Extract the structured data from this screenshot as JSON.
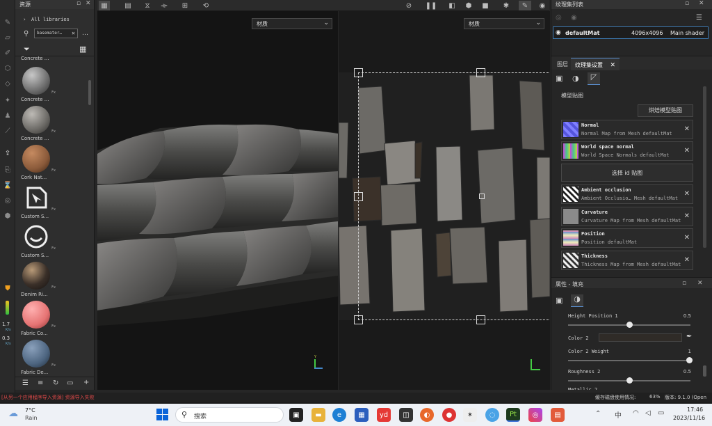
{
  "assets": {
    "title": "资源",
    "library_label": "All libraries",
    "search_value": "basemater…",
    "items": [
      {
        "label": "Concrete ...",
        "color": "#8a8a8a"
      },
      {
        "label": "Concrete ...",
        "color": "#7a7874"
      },
      {
        "label": "Cork Nat...",
        "color": "#8a5a3a"
      },
      {
        "label": "Custom S...",
        "color": "#f0f0f0"
      },
      {
        "label": "Custom S...",
        "color": "#f0f0f0"
      },
      {
        "label": "Denim Ri...",
        "color": "#3a2f28"
      },
      {
        "label": "Fabric Co...",
        "color": "#e57373"
      },
      {
        "label": "Fabric De...",
        "color": "#4d6580"
      }
    ],
    "stats": {
      "a": "1.7",
      "b": "0.3",
      "unit": "K/s"
    },
    "partial_top_label": "Concrete ..."
  },
  "viewport3d": {
    "material_select": "材质"
  },
  "viewport2d": {
    "material_select": "材质"
  },
  "texture_set_list": {
    "title": "纹理集列表",
    "row": {
      "name": "defaultMat",
      "resolution": "4096x4096",
      "shader": "Main shader"
    }
  },
  "tabs": {
    "layers": "图层",
    "settings": "纹理集设置"
  },
  "mesh_maps": {
    "heading": "模型贴图",
    "bake_button": "烘焙模型贴图",
    "select_id_button": "选择 id 贴图",
    "maps": [
      {
        "name": "Normal",
        "desc": "Normal Map from Mesh defaultMat"
      },
      {
        "name": "World space normal",
        "desc": "World Space Normals defaultMat"
      },
      {
        "name": "Ambient occlusion",
        "desc": "Ambient Occlusio… Mesh defaultMat"
      },
      {
        "name": "Curvature",
        "desc": "Curvature Map from Mesh defaultMat"
      },
      {
        "name": "Position",
        "desc": "Position defaultMat"
      },
      {
        "name": "Thickness",
        "desc": "Thickness Map from Mesh defaultMat"
      }
    ]
  },
  "properties": {
    "title": "属性 - 填充",
    "height_position": {
      "label": "Height Position 1",
      "value": "0.5",
      "level": 0.5
    },
    "color2": {
      "label": "Color 2"
    },
    "color2_weight": {
      "label": "Color 2 Weight",
      "value": "1",
      "level": 1.0
    },
    "roughness2": {
      "label": "Roughness 2",
      "value": "0.5",
      "level": 0.5
    },
    "metallic_partial": "Metallic 2"
  },
  "status": {
    "error": "[从另一个应用程序导入资源] 资源导入失败",
    "disk": "缓存磁盘使用情况:",
    "disk_pct": "63%",
    "version": "版本: 9.1.0 (Open"
  },
  "taskbar": {
    "weather_temp": "7°C",
    "weather_desc": "Rain",
    "search": "搜索",
    "time": "17:46",
    "date": "2023/11/16",
    "lang": "中"
  }
}
